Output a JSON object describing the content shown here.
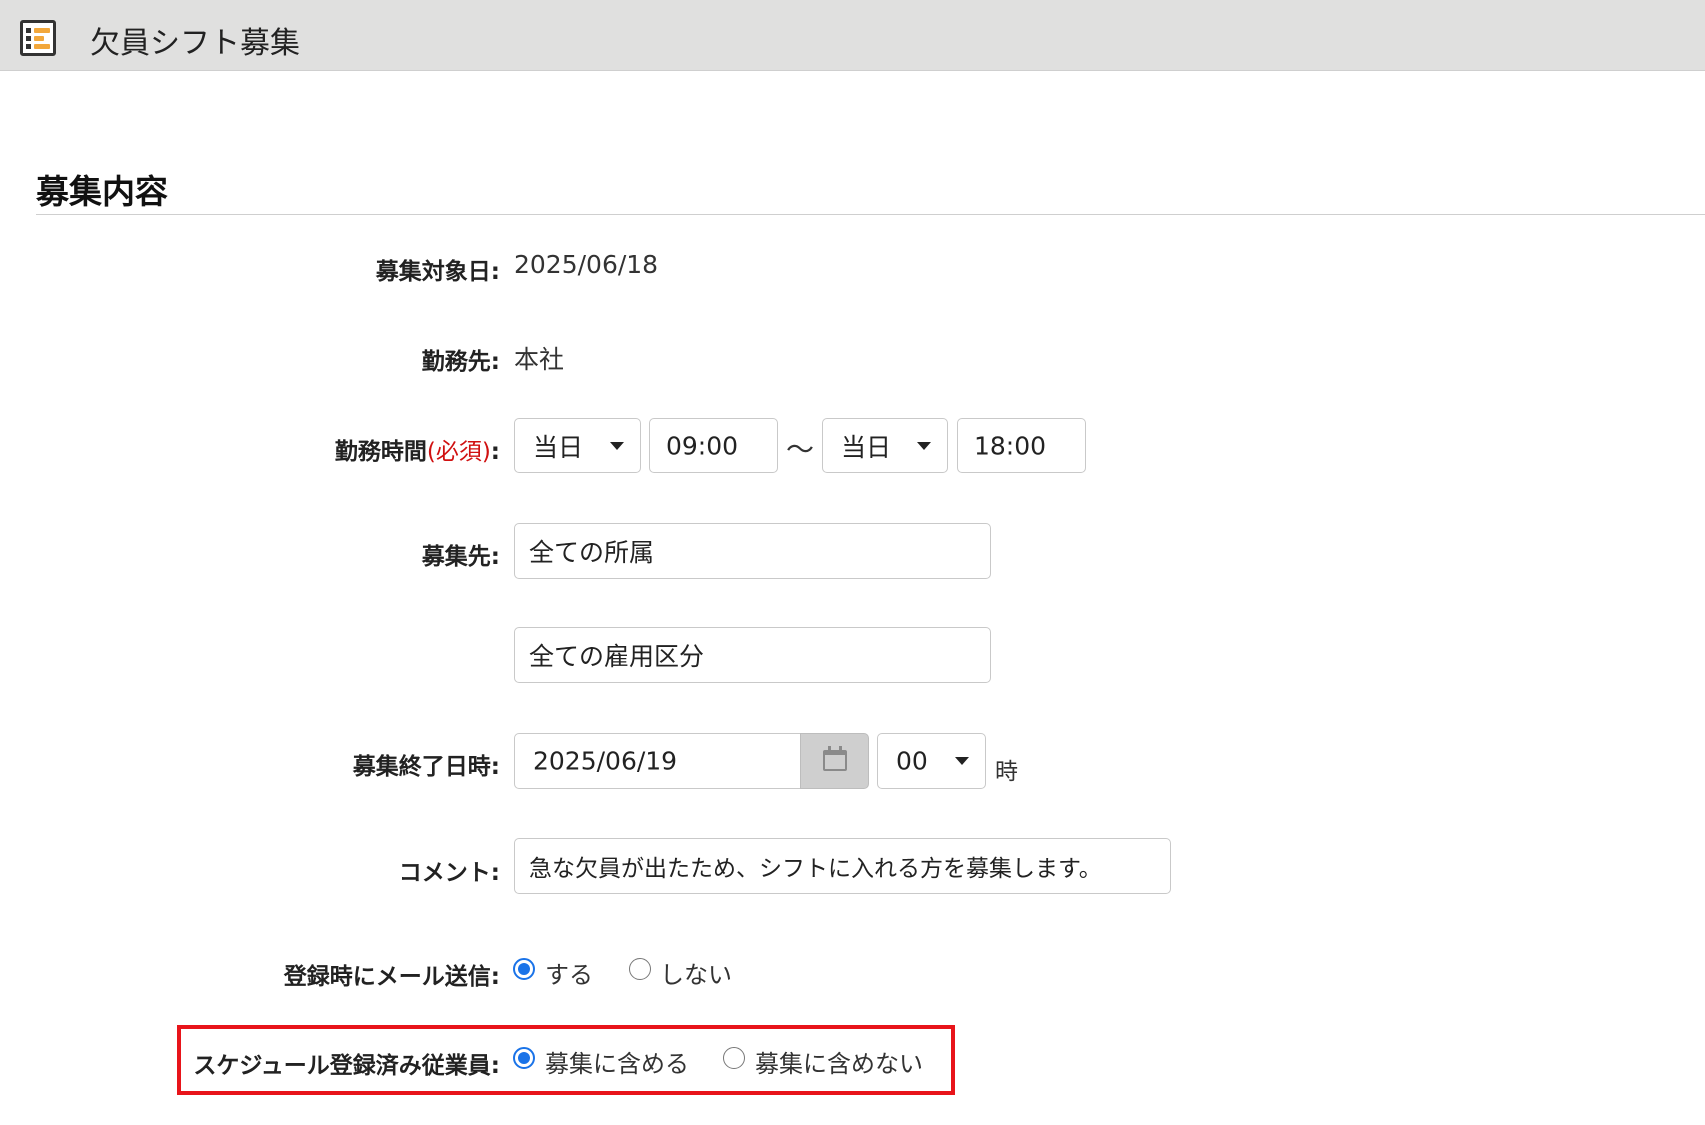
{
  "window": {
    "title": "欠員シフト募集",
    "icon": "shift-app-icon"
  },
  "section": {
    "title": "募集内容"
  },
  "fields": {
    "target_date": {
      "label": "募集対象日:",
      "value": "2025/06/18"
    },
    "workplace": {
      "label": "勤務先:",
      "value": "本社"
    },
    "work_time": {
      "label": "勤務時間",
      "required": "(必須)",
      "colon": ":",
      "start_day": "当日",
      "start_time": "09:00",
      "separator": "～",
      "end_day": "当日",
      "end_time": "18:00"
    },
    "recruit_to": {
      "label": "募集先:",
      "affiliation": "全ての所属",
      "employment_type": "全ての雇用区分"
    },
    "end_datetime": {
      "label": "募集終了日時:",
      "date": "2025/06/19",
      "hour": "00",
      "hour_unit": "時"
    },
    "comment": {
      "label": "コメント:",
      "value": "急な欠員が出たため、シフトに入れる方を募集します。"
    },
    "mail_on_register": {
      "label": "登録時にメール送信:",
      "options": [
        {
          "label": "する",
          "checked": true
        },
        {
          "label": "しない",
          "checked": false
        }
      ]
    },
    "scheduled_employees": {
      "label": "スケジュール登録済み従業員:",
      "options": [
        {
          "label": "募集に含める",
          "checked": true
        },
        {
          "label": "募集に含めない",
          "checked": false
        }
      ]
    }
  },
  "colors": {
    "required": "#d01010",
    "radio_selected": "#1a73e8",
    "highlight": "#e8141a",
    "titlebar": "#e0e0df"
  }
}
